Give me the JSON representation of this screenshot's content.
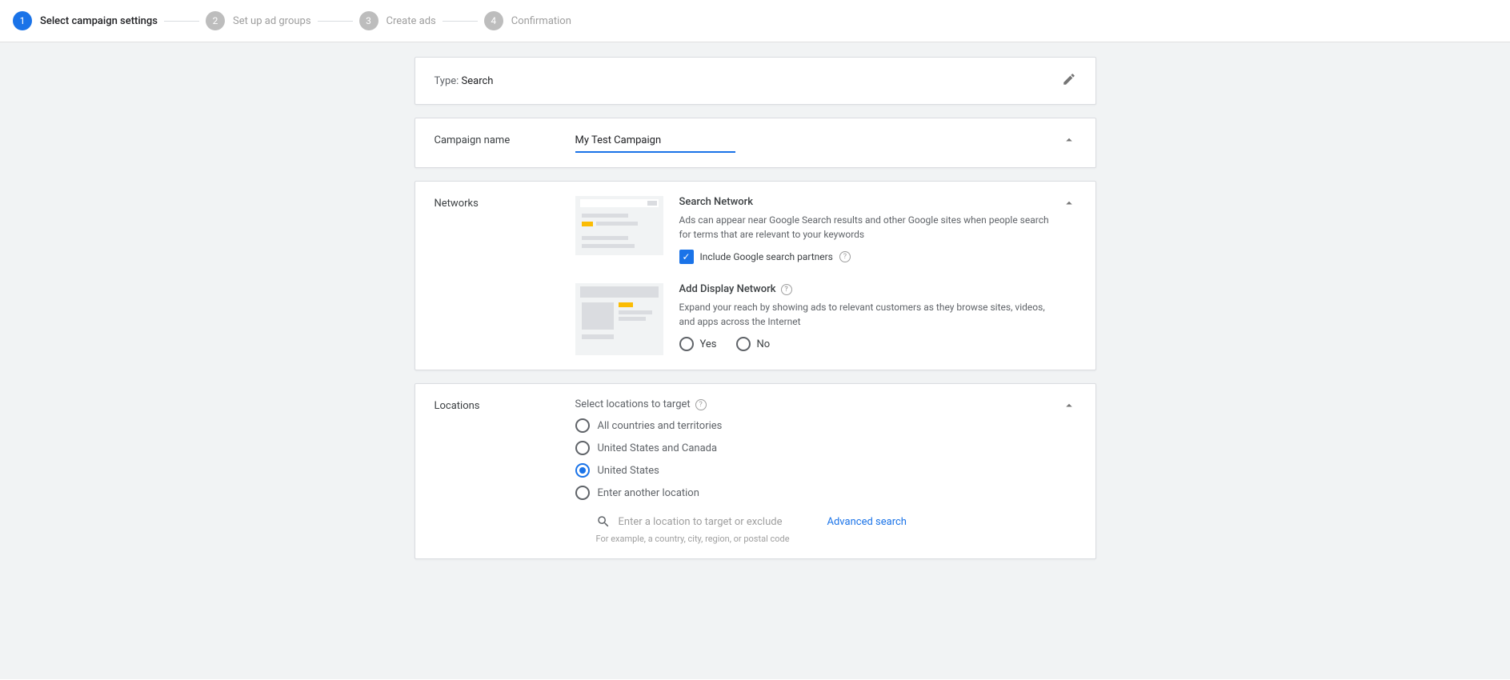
{
  "stepper": {
    "steps": [
      {
        "num": "1",
        "label": "Select campaign settings",
        "active": true
      },
      {
        "num": "2",
        "label": "Set up ad groups",
        "active": false
      },
      {
        "num": "3",
        "label": "Create ads",
        "active": false
      },
      {
        "num": "4",
        "label": "Confirmation",
        "active": false
      }
    ]
  },
  "type_card": {
    "prefix": "Type: ",
    "value": "Search"
  },
  "campaign_name": {
    "label": "Campaign name",
    "value": "My Test Campaign"
  },
  "networks": {
    "label": "Networks",
    "search": {
      "title": "Search Network",
      "desc": "Ads can appear near Google Search results and other Google sites when people search for terms that are relevant to your keywords",
      "checkbox_label": "Include Google search partners"
    },
    "display": {
      "title": "Add Display Network",
      "desc": "Expand your reach by showing ads to relevant customers as they browse sites, videos, and apps across the Internet",
      "opt_yes": "Yes",
      "opt_no": "No"
    }
  },
  "locations": {
    "label": "Locations",
    "prompt": "Select locations to target",
    "options": [
      "All countries and territories",
      "United States and Canada",
      "United States",
      "Enter another location"
    ],
    "selected_index": 2,
    "placeholder": "Enter a location to target or exclude",
    "advanced": "Advanced search",
    "hint": "For example, a country, city, region, or postal code"
  }
}
